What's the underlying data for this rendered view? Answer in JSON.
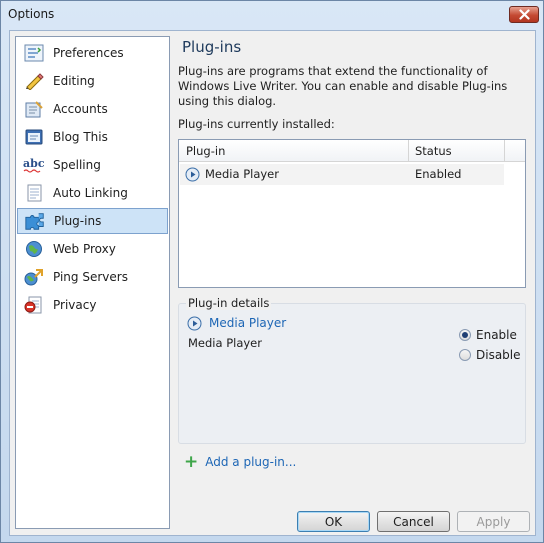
{
  "window": {
    "title": "Options",
    "close_icon": "close-icon"
  },
  "sidebar": {
    "items": [
      {
        "label": "Preferences",
        "icon": "preferences-icon"
      },
      {
        "label": "Editing",
        "icon": "pencil-icon"
      },
      {
        "label": "Accounts",
        "icon": "accounts-icon"
      },
      {
        "label": "Blog This",
        "icon": "blog-this-icon"
      },
      {
        "label": "Spelling",
        "icon": "spelling-icon"
      },
      {
        "label": "Auto Linking",
        "icon": "document-icon"
      },
      {
        "label": "Plug-ins",
        "icon": "puzzle-icon",
        "selected": true
      },
      {
        "label": "Web Proxy",
        "icon": "globe-icon"
      },
      {
        "label": "Ping Servers",
        "icon": "ping-servers-icon"
      },
      {
        "label": "Privacy",
        "icon": "privacy-icon"
      }
    ]
  },
  "pane": {
    "title": "Plug-ins",
    "description": "Plug-ins are programs that extend the functionality of Windows Live Writer. You can enable and disable Plug-ins using this dialog.",
    "installed_label": "Plug-ins currently installed:",
    "columns": [
      "Plug-in",
      "Status"
    ],
    "rows": [
      {
        "name": "Media Player",
        "status": "Enabled"
      }
    ],
    "details": {
      "legend": "Plug-in details",
      "name": "Media Player",
      "sub": "Media Player",
      "enable_label": "Enable",
      "disable_label": "Disable",
      "selected": "Enable"
    },
    "add_link": "Add a plug-in..."
  },
  "buttons": {
    "ok": "OK",
    "cancel": "Cancel",
    "apply": "Apply"
  },
  "colors": {
    "accent": "#1d66b5",
    "selection": "#cde3f7",
    "close": "#c44a33"
  }
}
